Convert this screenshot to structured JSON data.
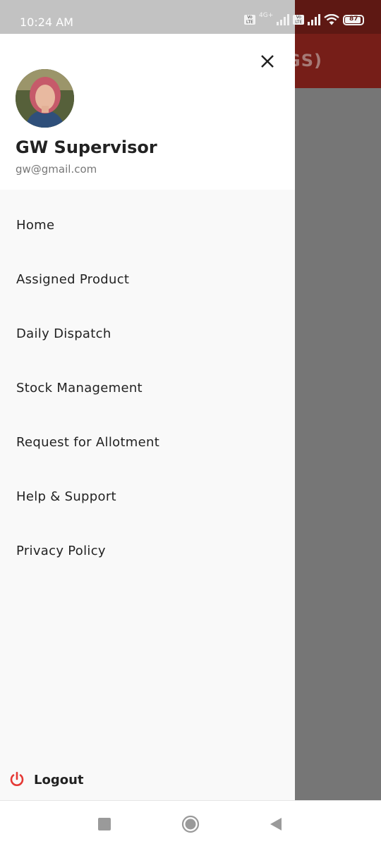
{
  "status_bar": {
    "time": "10:24 AM",
    "network_label": "4G+",
    "battery": "87"
  },
  "background_app": {
    "title_fragment": "GS)"
  },
  "drawer": {
    "user": {
      "name": "GW Supervisor",
      "email": "gw@gmail.com"
    },
    "menu_items": [
      "Home",
      "Assigned Product",
      "Daily Dispatch",
      "Stock Management",
      "Request for Allotment",
      "Help & Support",
      "Privacy Policy"
    ],
    "logout_label": "Logout"
  },
  "colors": {
    "app_primary": "#761e18",
    "drawer_bg": "#f9f9f9",
    "logout_icon": "#e53935"
  },
  "icons": {
    "close": "close-icon",
    "logout": "power-icon",
    "nav_recents": "square-icon",
    "nav_home": "circle-icon",
    "nav_back": "triangle-back-icon"
  }
}
